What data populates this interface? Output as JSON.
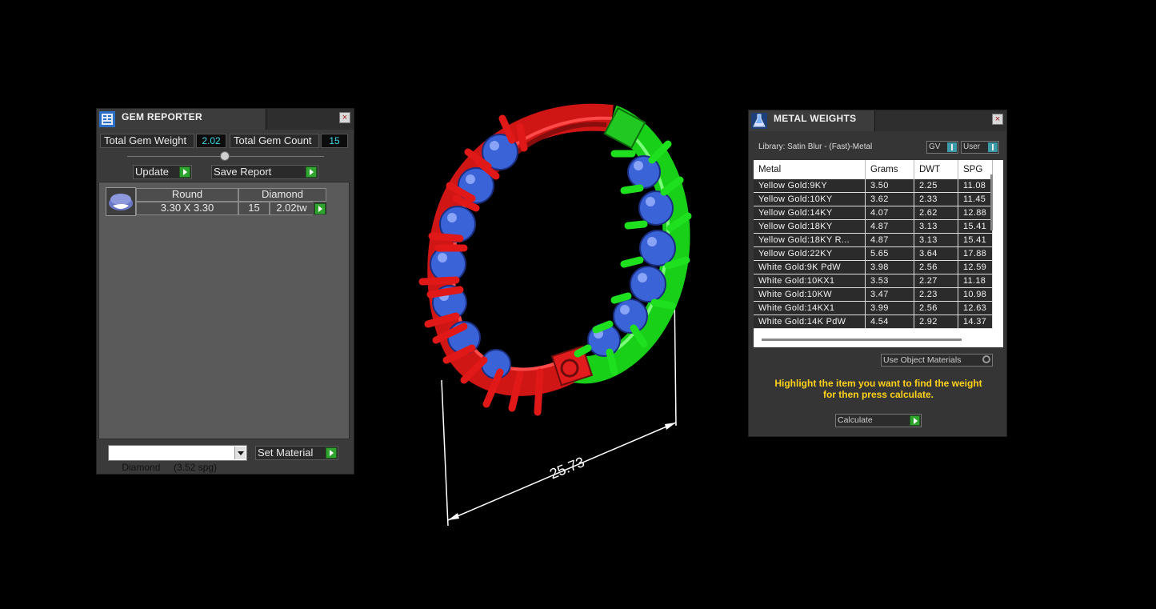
{
  "gem_reporter": {
    "title": "GEM REPORTER",
    "close": "×",
    "total_weight_label": "Total Gem Weight",
    "total_weight_value": "2.02",
    "total_count_label": "Total Gem Count",
    "total_count_value": "15",
    "update_label": "Update",
    "save_label": "Save Report",
    "row": {
      "shape": "Round",
      "size": "3.30 X 3.30",
      "material": "Diamond",
      "count": "15",
      "weight": "2.02tw"
    },
    "material_select": "Diamond     (3.52 spg)",
    "set_material_label": "Set Material"
  },
  "viewport": {
    "dimension": "25.73",
    "colors": {
      "stones": "#3a63d8",
      "selected_metal": "#1ee01e",
      "unselected_metal": "#e01818",
      "dimension": "#ffffff"
    }
  },
  "metal_weights": {
    "title": "METAL WEIGHTS",
    "close": "×",
    "library": "Library: Satin Blur - (Fast)-Metal",
    "gv_label": "GV",
    "user_label": "User",
    "columns": [
      "Metal",
      "Grams",
      "DWT",
      "SPG"
    ],
    "rows": [
      [
        "Yellow Gold:9KY",
        "3.50",
        "2.25",
        "11.08"
      ],
      [
        "Yellow Gold:10KY",
        "3.62",
        "2.33",
        "11.45"
      ],
      [
        "Yellow Gold:14KY",
        "4.07",
        "2.62",
        "12.88"
      ],
      [
        "Yellow Gold:18KY",
        "4.87",
        "3.13",
        "15.41"
      ],
      [
        "Yellow Gold:18KY R...",
        "4.87",
        "3.13",
        "15.41"
      ],
      [
        "Yellow Gold:22KY",
        "5.65",
        "3.64",
        "17.88"
      ],
      [
        "White Gold:9K PdW",
        "3.98",
        "2.56",
        "12.59"
      ],
      [
        "White Gold:10KX1",
        "3.53",
        "2.27",
        "11.18"
      ],
      [
        "White Gold:10KW",
        "3.47",
        "2.23",
        "10.98"
      ],
      [
        "White Gold:14KX1",
        "3.99",
        "2.56",
        "12.63"
      ],
      [
        "White Gold:14K PdW",
        "4.54",
        "2.92",
        "14.37"
      ]
    ],
    "use_object_label": "Use Object Materials",
    "hint_line1": "Highlight the item you want to find the weight",
    "hint_line2": "for then press calculate.",
    "hint_color": "#ffd21a",
    "calculate_label": "Calculate"
  }
}
